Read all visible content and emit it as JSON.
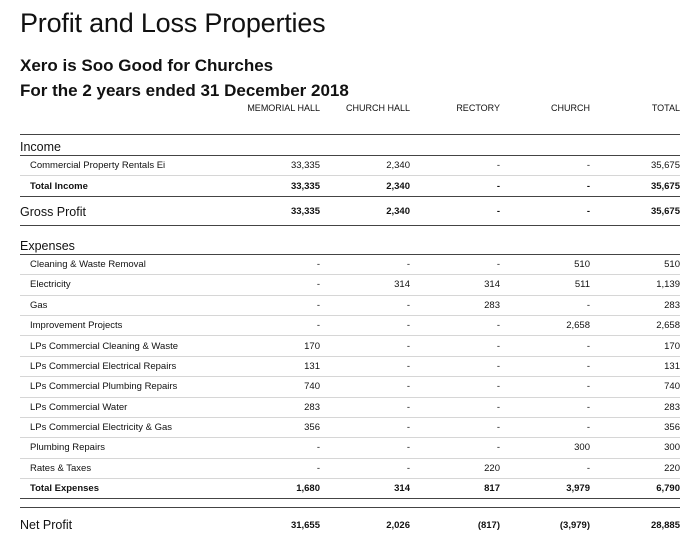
{
  "report": {
    "title": "Profit and Loss Properties",
    "org": "Xero is Soo Good for Churches",
    "period": "For the 2 years ended 31 December 2018"
  },
  "columns": [
    "MEMORIAL HALL",
    "CHURCH HALL",
    "RECTORY",
    "CHURCH",
    "TOTAL"
  ],
  "income": {
    "heading": "Income",
    "rows": [
      {
        "label": "Commercial Property Rentals Ei",
        "values": [
          "33,335",
          "2,340",
          "-",
          "-",
          "35,675"
        ]
      }
    ],
    "total": {
      "label": "Total Income",
      "values": [
        "33,335",
        "2,340",
        "-",
        "-",
        "35,675"
      ]
    }
  },
  "gross_profit": {
    "label": "Gross Profit",
    "values": [
      "33,335",
      "2,340",
      "-",
      "-",
      "35,675"
    ]
  },
  "expenses": {
    "heading": "Expenses",
    "rows": [
      {
        "label": "Cleaning & Waste Removal",
        "values": [
          "-",
          "-",
          "-",
          "510",
          "510"
        ]
      },
      {
        "label": "Electricity",
        "values": [
          "-",
          "314",
          "314",
          "511",
          "1,139"
        ]
      },
      {
        "label": "Gas",
        "values": [
          "-",
          "-",
          "283",
          "-",
          "283"
        ]
      },
      {
        "label": "Improvement Projects",
        "values": [
          "-",
          "-",
          "-",
          "2,658",
          "2,658"
        ]
      },
      {
        "label": "LPs Commercial Cleaning & Waste",
        "values": [
          "170",
          "-",
          "-",
          "-",
          "170"
        ]
      },
      {
        "label": "LPs Commercial Electrical Repairs",
        "values": [
          "131",
          "-",
          "-",
          "-",
          "131"
        ]
      },
      {
        "label": "LPs Commercial Plumbing Repairs",
        "values": [
          "740",
          "-",
          "-",
          "-",
          "740"
        ]
      },
      {
        "label": "LPs Commercial Water",
        "values": [
          "283",
          "-",
          "-",
          "-",
          "283"
        ]
      },
      {
        "label": "LPs Commercial Electricity & Gas",
        "values": [
          "356",
          "-",
          "-",
          "-",
          "356"
        ]
      },
      {
        "label": "Plumbing Repairs",
        "values": [
          "-",
          "-",
          "-",
          "300",
          "300"
        ]
      },
      {
        "label": "Rates & Taxes",
        "values": [
          "-",
          "-",
          "220",
          "-",
          "220"
        ]
      }
    ],
    "total": {
      "label": "Total Expenses",
      "values": [
        "1,680",
        "314",
        "817",
        "3,979",
        "6,790"
      ]
    }
  },
  "net_profit": {
    "label": "Net Profit",
    "values": [
      "31,655",
      "2,026",
      "(817)",
      "(3,979)",
      "28,885"
    ]
  }
}
